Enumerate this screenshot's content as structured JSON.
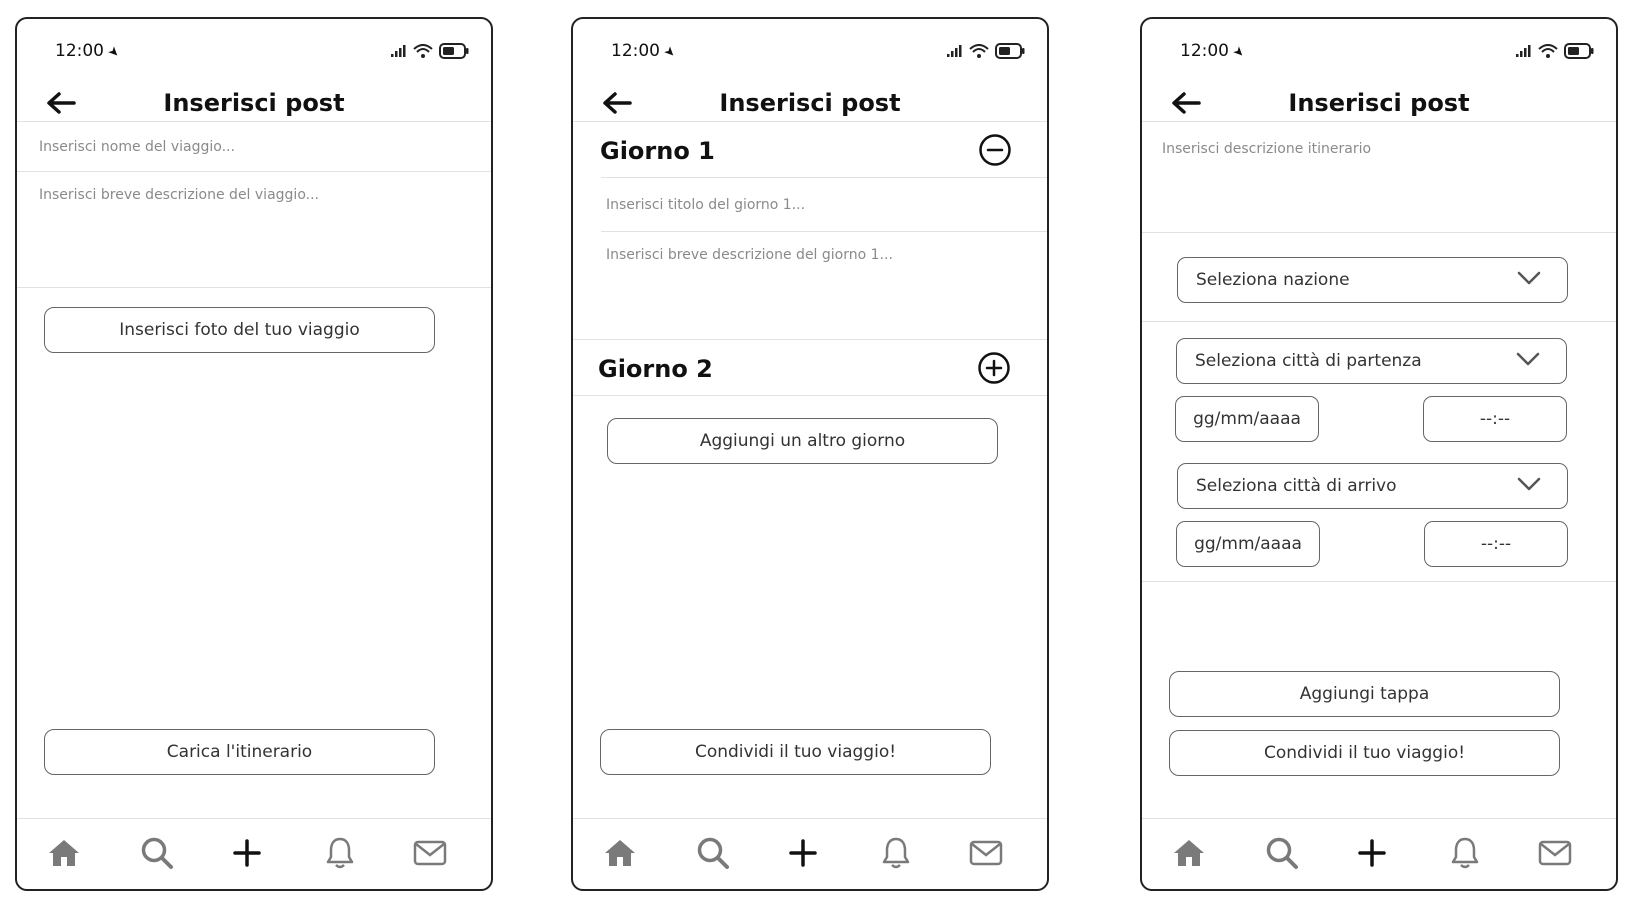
{
  "colors": {
    "icon_gray": "#7a7a7a",
    "border": "#666666",
    "placeholder": "#8a8a8a"
  },
  "status_bar": {
    "time": "12:00"
  },
  "screen1": {
    "title": "Inserisci post",
    "trip_name_placeholder": "Inserisci nome del viaggio...",
    "trip_desc_placeholder": "Inserisci breve descrizione del viaggio...",
    "upload_photo_label": "Inserisci foto del tuo viaggio",
    "upload_itinerary_label": "Carica l'itinerario"
  },
  "screen2": {
    "title": "Inserisci post",
    "day1_title": "Giorno 1",
    "day1_title_placeholder": "Inserisci titolo del giorno 1...",
    "day1_desc_placeholder": "Inserisci breve descrizione del giorno 1...",
    "day2_title": "Giorno 2",
    "add_day_label": "Aggiungi un altro giorno",
    "share_label": "Condividi il tuo viaggio!"
  },
  "screen3": {
    "title": "Inserisci post",
    "itinerary_desc_placeholder": "Inserisci descrizione itinerario",
    "country_select": "Seleziona nazione",
    "departure_city_select": "Seleziona città di partenza",
    "departure_date": "gg/mm/aaaa",
    "departure_time": "--:--",
    "arrival_city_select": "Seleziona città di arrivo",
    "arrival_date": "gg/mm/aaaa",
    "arrival_time": "--:--",
    "add_stop_label": "Aggiungi tappa",
    "share_label": "Condividi il tuo viaggio!"
  },
  "tabbar_icons": [
    "home-icon",
    "search-icon",
    "plus-icon",
    "bell-icon",
    "mail-icon"
  ]
}
